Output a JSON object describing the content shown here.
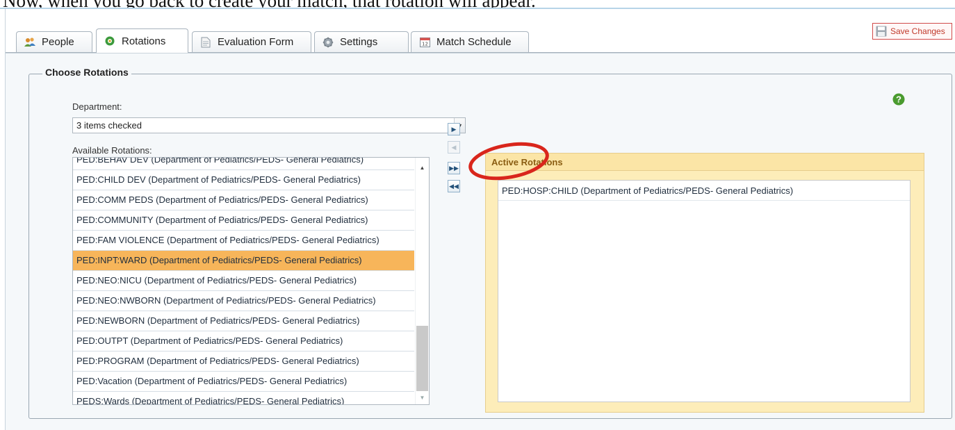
{
  "caption": "Now, when you go back to create your match, that rotation will appear.",
  "tabs": [
    {
      "label": "People",
      "icon": "people-icon",
      "active": false
    },
    {
      "label": "Rotations",
      "icon": "rotations-icon",
      "active": true
    },
    {
      "label": "Evaluation Form",
      "icon": "document-icon",
      "active": false
    },
    {
      "label": "Settings",
      "icon": "gear-icon",
      "active": false
    },
    {
      "label": "Match Schedule",
      "icon": "calendar-icon",
      "active": false
    }
  ],
  "save_label": "Save Changes",
  "section_title": "Choose Rotations",
  "department": {
    "label": "Department:",
    "value": "3 items checked"
  },
  "available": {
    "label": "Available Rotations:",
    "items": [
      "PED:BEHAV DEV (Department of Pediatrics/PEDS- General Pediatrics)",
      "PED:CHILD DEV (Department of Pediatrics/PEDS- General Pediatrics)",
      "PED:COMM PEDS (Department of Pediatrics/PEDS- General Pediatrics)",
      "PED:COMMUNITY (Department of Pediatrics/PEDS- General Pediatrics)",
      "PED:FAM VIOLENCE (Department of Pediatrics/PEDS- General Pediatrics)",
      "PED:INPT:WARD (Department of Pediatrics/PEDS- General Pediatrics)",
      "PED:NEO:NICU (Department of Pediatrics/PEDS- General Pediatrics)",
      "PED:NEO:NWBORN (Department of Pediatrics/PEDS- General Pediatrics)",
      "PED:NEWBORN (Department of Pediatrics/PEDS- General Pediatrics)",
      "PED:OUTPT (Department of Pediatrics/PEDS- General Pediatrics)",
      "PED:PROGRAM (Department of Pediatrics/PEDS- General Pediatrics)",
      "PED:Vacation (Department of Pediatrics/PEDS- General Pediatrics)",
      "PEDS:Wards (Department of Pediatrics/PEDS- General Pediatrics)"
    ],
    "selected_index": 5
  },
  "move_buttons": [
    {
      "name": "move-right-button",
      "glyph": "▶",
      "enabled": true
    },
    {
      "name": "move-left-button",
      "glyph": "◀",
      "enabled": false
    },
    {
      "name": "move-all-right-button",
      "glyph": "▶▶",
      "enabled": true
    },
    {
      "name": "move-all-left-button",
      "glyph": "◀◀",
      "enabled": true
    }
  ],
  "active": {
    "header": "Active Rotations",
    "items": [
      "PED:HOSP:CHILD (Department of Pediatrics/PEDS- General Pediatrics)"
    ]
  },
  "colors": {
    "selected_row": "#f7b55a",
    "active_panel": "#fdedb9",
    "annotation_circle": "#d9261c",
    "help_icon": "#4a9b2f",
    "save_button": "#c0392b"
  }
}
